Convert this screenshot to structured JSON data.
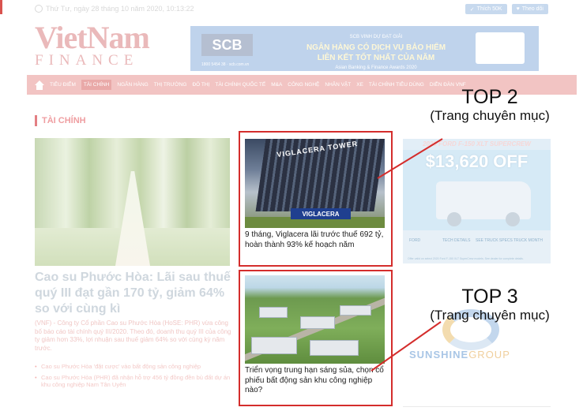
{
  "topbar": {
    "date": "Thứ Tư, ngày 28 tháng 10 năm 2020, 10:13:22",
    "like_button": "Thích 50K",
    "follow_button": "Theo dõi"
  },
  "logo": {
    "main": "VietNam",
    "sub": "FINANCE"
  },
  "banner": {
    "brand": "SCB",
    "kicker": "SCB VINH DỰ ĐẠT GIẢI",
    "line1": "NGÂN HÀNG CÓ DỊCH VỤ BẢO HIỂM",
    "line2": "LIÊN KẾT TỐT NHẤT CỦA NĂM",
    "note": "Asian Banking & Finance Awards 2020",
    "footer": "1800 5454 38 · scb.com.vn"
  },
  "nav": {
    "items": [
      "TIÊU ĐIỂM",
      "TÀI CHÍNH",
      "NGÂN HÀNG",
      "THỊ TRƯỜNG",
      "ĐÔ THỊ",
      "TÀI CHÍNH QUỐC TẾ",
      "M&A",
      "CÔNG NGHỆ",
      "NHÂN VẬT",
      "XE",
      "TÀI CHÍNH TIÊU DÙNG",
      "DIỄN ĐÀN VNF"
    ],
    "active_index": 1
  },
  "section": {
    "title": "TÀI CHÍNH"
  },
  "feature": {
    "title": "Cao su Phước Hòa: Lãi sau thuế quý III đạt gần 170 tỷ, giảm 64% so với cùng kì",
    "summary": "(VNF) - Công ty Cổ phần Cao su Phước Hòa (HoSE: PHR) vừa công bố báo cáo tài chính quý III/2020. Theo đó, doanh thu quý III của công ty giảm hơn 33%, lợi nhuận sau thuế giảm 64% so với cùng kỳ năm trước.",
    "bullets": [
      "Cao su Phước Hòa 'đặt cược' vào bất động sản công nghiệp",
      "Cao su Phước Hòa (PHR) đã nhận hỗ trợ 456 tỷ đồng đền bù đất dự án khu công nghiệp Nam Tân Uyên"
    ]
  },
  "cards": [
    {
      "title": "9 tháng, Viglacera lãi trước thuế 692 tỷ, hoàn thành 93% kế hoạch năm",
      "image_sign": "VIGLACERA TOWER",
      "image_logo": "VIGLACERA",
      "image_subsign": "TỔNG CÔNG TY"
    },
    {
      "title": "Triển vọng trung hạn sáng sủa, chọn cổ phiếu bất động sản khu công nghiệp nào?"
    }
  ],
  "ad": {
    "headline": "2020 FORD F-150 XLT SUPERCREW",
    "price": "$13,620 OFF",
    "msrp": "MSRP",
    "brand": "FORD",
    "badges": [
      "TECH DETAILS",
      "SEE TRUCK SPECS",
      "TRUCK MONTH"
    ],
    "fineprint": "Offer valid on select 2020 Ford F-150 XLT SuperCrew models. See dealer for complete details."
  },
  "sunshine": {
    "brand": "SUNSHINE",
    "group": "GROUP"
  },
  "callouts": [
    {
      "label": "TOP 2",
      "sub": "(Trang chuyên mục)"
    },
    {
      "label": "TOP 3",
      "sub": "(Trang chuyên mục)"
    }
  ],
  "colors": {
    "highlight_border": "#d42d2c",
    "nav_bg": "#f2c4c3",
    "brand_red": "#c0282d"
  },
  "icons": [
    "clock-icon",
    "thumbs-up-icon",
    "twitter-icon",
    "home-icon"
  ]
}
